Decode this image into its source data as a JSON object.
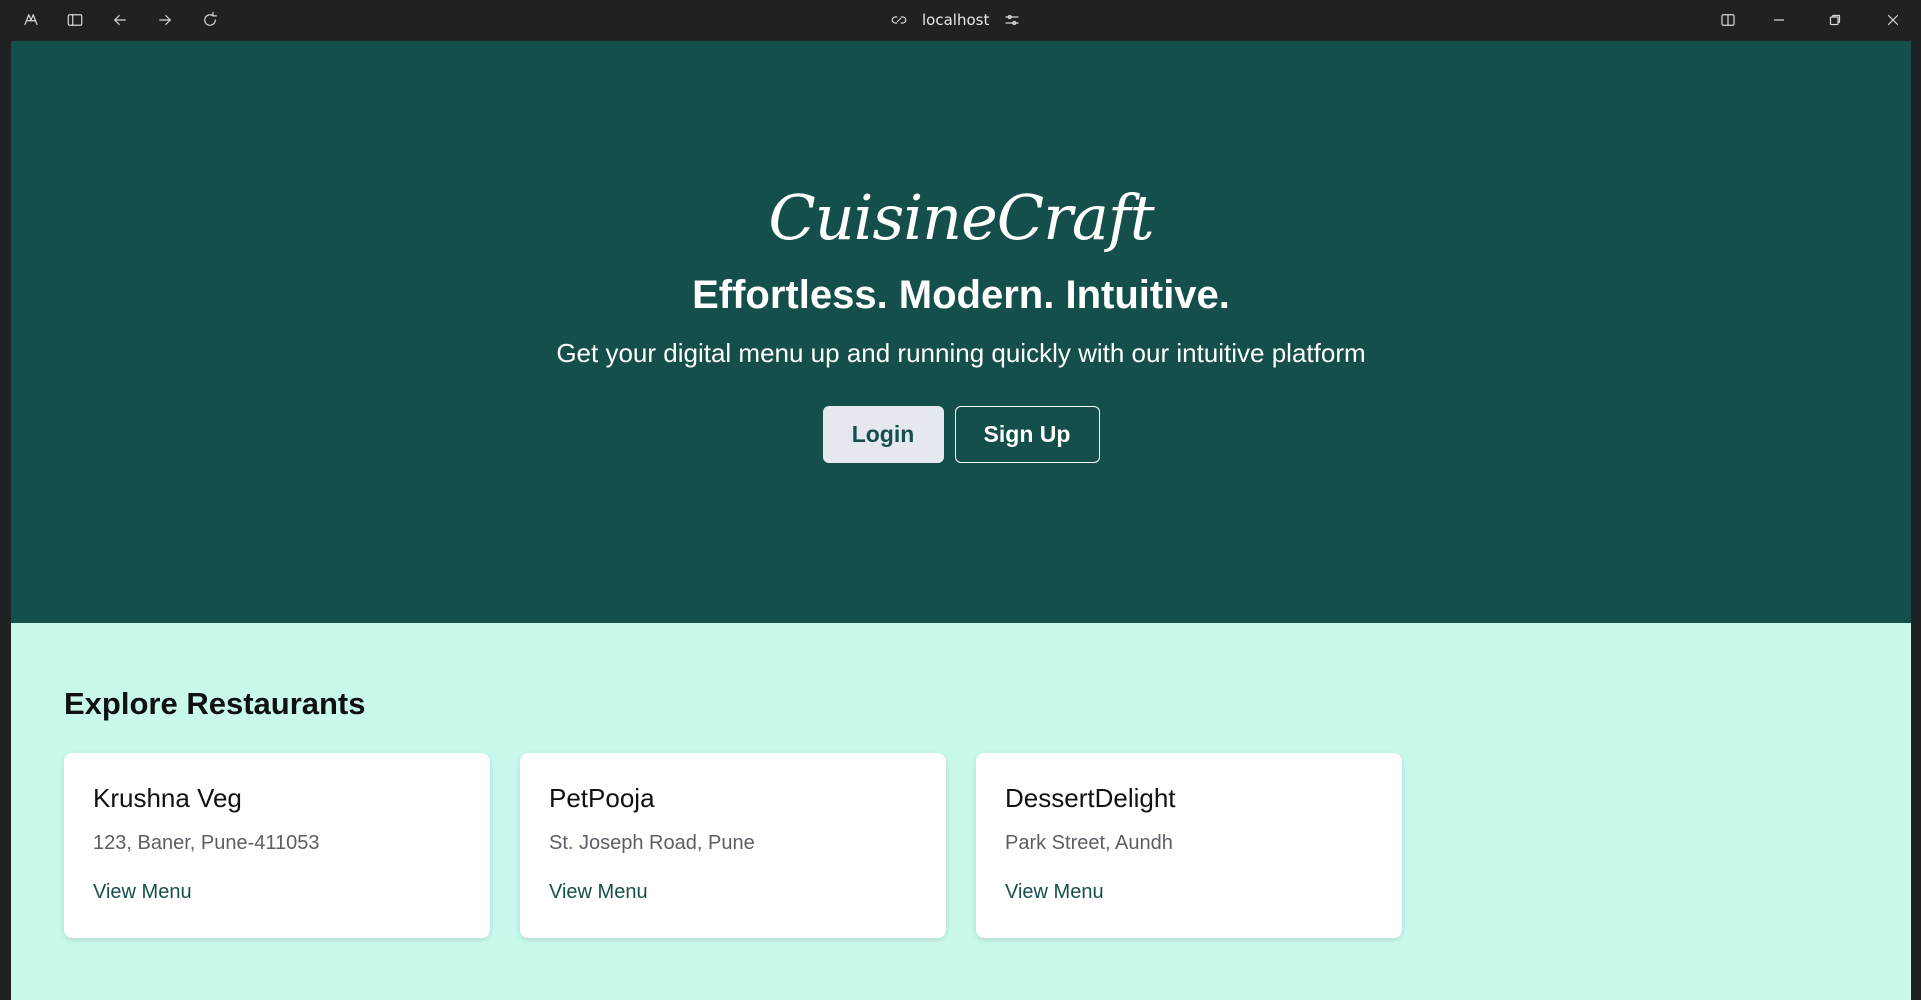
{
  "browser": {
    "address": "localhost",
    "icons": [
      "app-logo-icon",
      "sidebar-toggle-icon",
      "back-arrow-icon",
      "forward-arrow-icon",
      "reload-icon",
      "link-icon",
      "tune-icon",
      "split-view-icon",
      "minimize-icon",
      "restore-icon",
      "close-icon"
    ]
  },
  "hero": {
    "brand": "CuisineCraft",
    "tagline": "Effortless. Modern. Intuitive.",
    "subline": "Get your digital menu up and running quickly with our intuitive platform",
    "login_label": "Login",
    "signup_label": "Sign Up"
  },
  "explore": {
    "title": "Explore Restaurants",
    "restaurants": [
      {
        "name": "Krushna Veg",
        "address": "123, Baner, Pune-411053",
        "link": "View Menu"
      },
      {
        "name": "PetPooja",
        "address": "St. Joseph Road, Pune",
        "link": "View Menu"
      },
      {
        "name": "DessertDelight",
        "address": "Park Street, Aundh",
        "link": "View Menu"
      }
    ]
  },
  "colors": {
    "hero_bg": "#154f4c",
    "section_bg": "#c9f8ec",
    "login_bg": "#e5e8ef",
    "chrome_bg": "#1f2125"
  }
}
